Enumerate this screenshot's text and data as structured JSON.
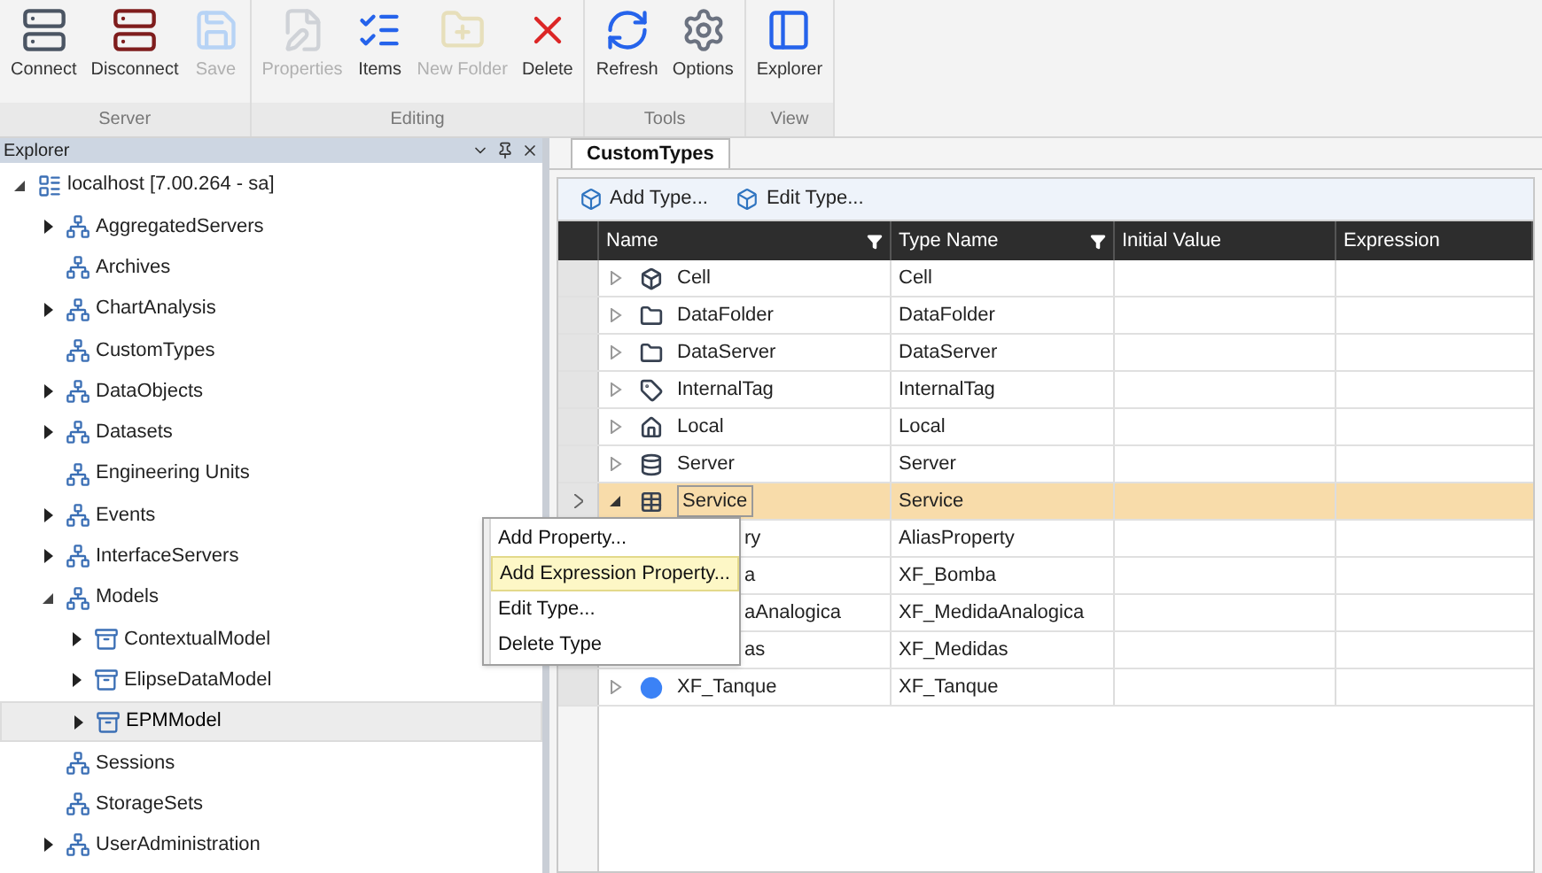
{
  "ribbon": {
    "groups": [
      {
        "label": "Server",
        "buttons": [
          {
            "label": "Connect",
            "disabled": false
          },
          {
            "label": "Disconnect",
            "disabled": false
          },
          {
            "label": "Save",
            "disabled": true
          }
        ]
      },
      {
        "label": "Editing",
        "buttons": [
          {
            "label": "Properties",
            "disabled": true
          },
          {
            "label": "Items",
            "disabled": false
          },
          {
            "label": "New Folder",
            "disabled": true
          },
          {
            "label": "Delete",
            "disabled": false
          }
        ]
      },
      {
        "label": "Tools",
        "buttons": [
          {
            "label": "Refresh",
            "disabled": false
          },
          {
            "label": "Options",
            "disabled": false
          }
        ]
      },
      {
        "label": "View",
        "buttons": [
          {
            "label": "Explorer",
            "disabled": false
          }
        ]
      }
    ]
  },
  "explorer": {
    "title": "Explorer",
    "tree": [
      {
        "label": "localhost [7.00.264 - sa]",
        "kind": "branch",
        "expanded": true,
        "selected": false,
        "children": [
          {
            "label": "AggregatedServers",
            "kind": "branch",
            "expanded": false,
            "selected": false
          },
          {
            "label": "Archives",
            "kind": "leaf",
            "selected": false
          },
          {
            "label": "ChartAnalysis",
            "kind": "branch",
            "expanded": false,
            "selected": false
          },
          {
            "label": "CustomTypes",
            "kind": "leaf",
            "selected": false
          },
          {
            "label": "DataObjects",
            "kind": "branch",
            "expanded": false,
            "selected": false
          },
          {
            "label": "Datasets",
            "kind": "branch",
            "expanded": false,
            "selected": false
          },
          {
            "label": "Engineering Units",
            "kind": "leaf",
            "selected": false
          },
          {
            "label": "Events",
            "kind": "branch",
            "expanded": false,
            "selected": false
          },
          {
            "label": "InterfaceServers",
            "kind": "branch",
            "expanded": false,
            "selected": false
          },
          {
            "label": "Models",
            "kind": "branch",
            "expanded": true,
            "selected": false,
            "children": [
              {
                "label": "ContextualModel",
                "kind": "branch",
                "expanded": false,
                "selected": false
              },
              {
                "label": "ElipseDataModel",
                "kind": "branch",
                "expanded": false,
                "selected": false
              },
              {
                "label": "EPMModel",
                "kind": "branch",
                "expanded": false,
                "selected": true
              }
            ]
          },
          {
            "label": "Sessions",
            "kind": "leaf",
            "selected": false
          },
          {
            "label": "StorageSets",
            "kind": "leaf",
            "selected": false
          },
          {
            "label": "UserAdministration",
            "kind": "branch",
            "expanded": false,
            "selected": false
          }
        ]
      }
    ]
  },
  "document": {
    "tabs": [
      {
        "label": "CustomTypes",
        "selected": true
      }
    ],
    "toolbar": [
      "Add Type...",
      "Edit Type..."
    ],
    "table": {
      "columns": [
        "Name",
        "Type Name",
        "Initial Value",
        "Expression"
      ],
      "rows": [
        {
          "name": "Cell",
          "type_name": "Cell",
          "selected": false,
          "expanded": false,
          "kind": "visible"
        },
        {
          "name": "DataFolder",
          "type_name": "DataFolder",
          "selected": false,
          "expanded": false,
          "kind": "visible"
        },
        {
          "name": "DataServer",
          "type_name": "DataServer",
          "selected": false,
          "expanded": false,
          "kind": "visible"
        },
        {
          "name": "InternalTag",
          "type_name": "InternalTag",
          "selected": false,
          "expanded": false,
          "kind": "visible"
        },
        {
          "name": "Local",
          "type_name": "Local",
          "selected": false,
          "expanded": false,
          "kind": "visible"
        },
        {
          "name": "Server",
          "type_name": "Server",
          "selected": false,
          "expanded": false,
          "kind": "visible"
        },
        {
          "name": "Service",
          "type_name": "Service",
          "selected": true,
          "expanded": true,
          "kind": "visible"
        },
        {
          "name": "ry",
          "type_name": "AliasProperty",
          "selected": false,
          "kind": "covered"
        },
        {
          "name": "a",
          "type_name": "XF_Bomba",
          "selected": false,
          "kind": "covered"
        },
        {
          "name": "aAnalogica",
          "type_name": "XF_MedidaAnalogica",
          "selected": false,
          "kind": "covered"
        },
        {
          "name": "as",
          "type_name": "XF_Medidas",
          "selected": false,
          "kind": "covered"
        },
        {
          "name": "XF_Tanque",
          "type_name": "XF_Tanque",
          "selected": false,
          "expanded": false,
          "kind": "visible"
        }
      ]
    }
  },
  "context_menu": [
    {
      "label": "Add Property...",
      "selected": false
    },
    {
      "label": "Add Expression Property...",
      "selected": true
    },
    {
      "label": "Edit Type...",
      "selected": false
    },
    {
      "label": "Delete Type",
      "selected": false
    }
  ]
}
